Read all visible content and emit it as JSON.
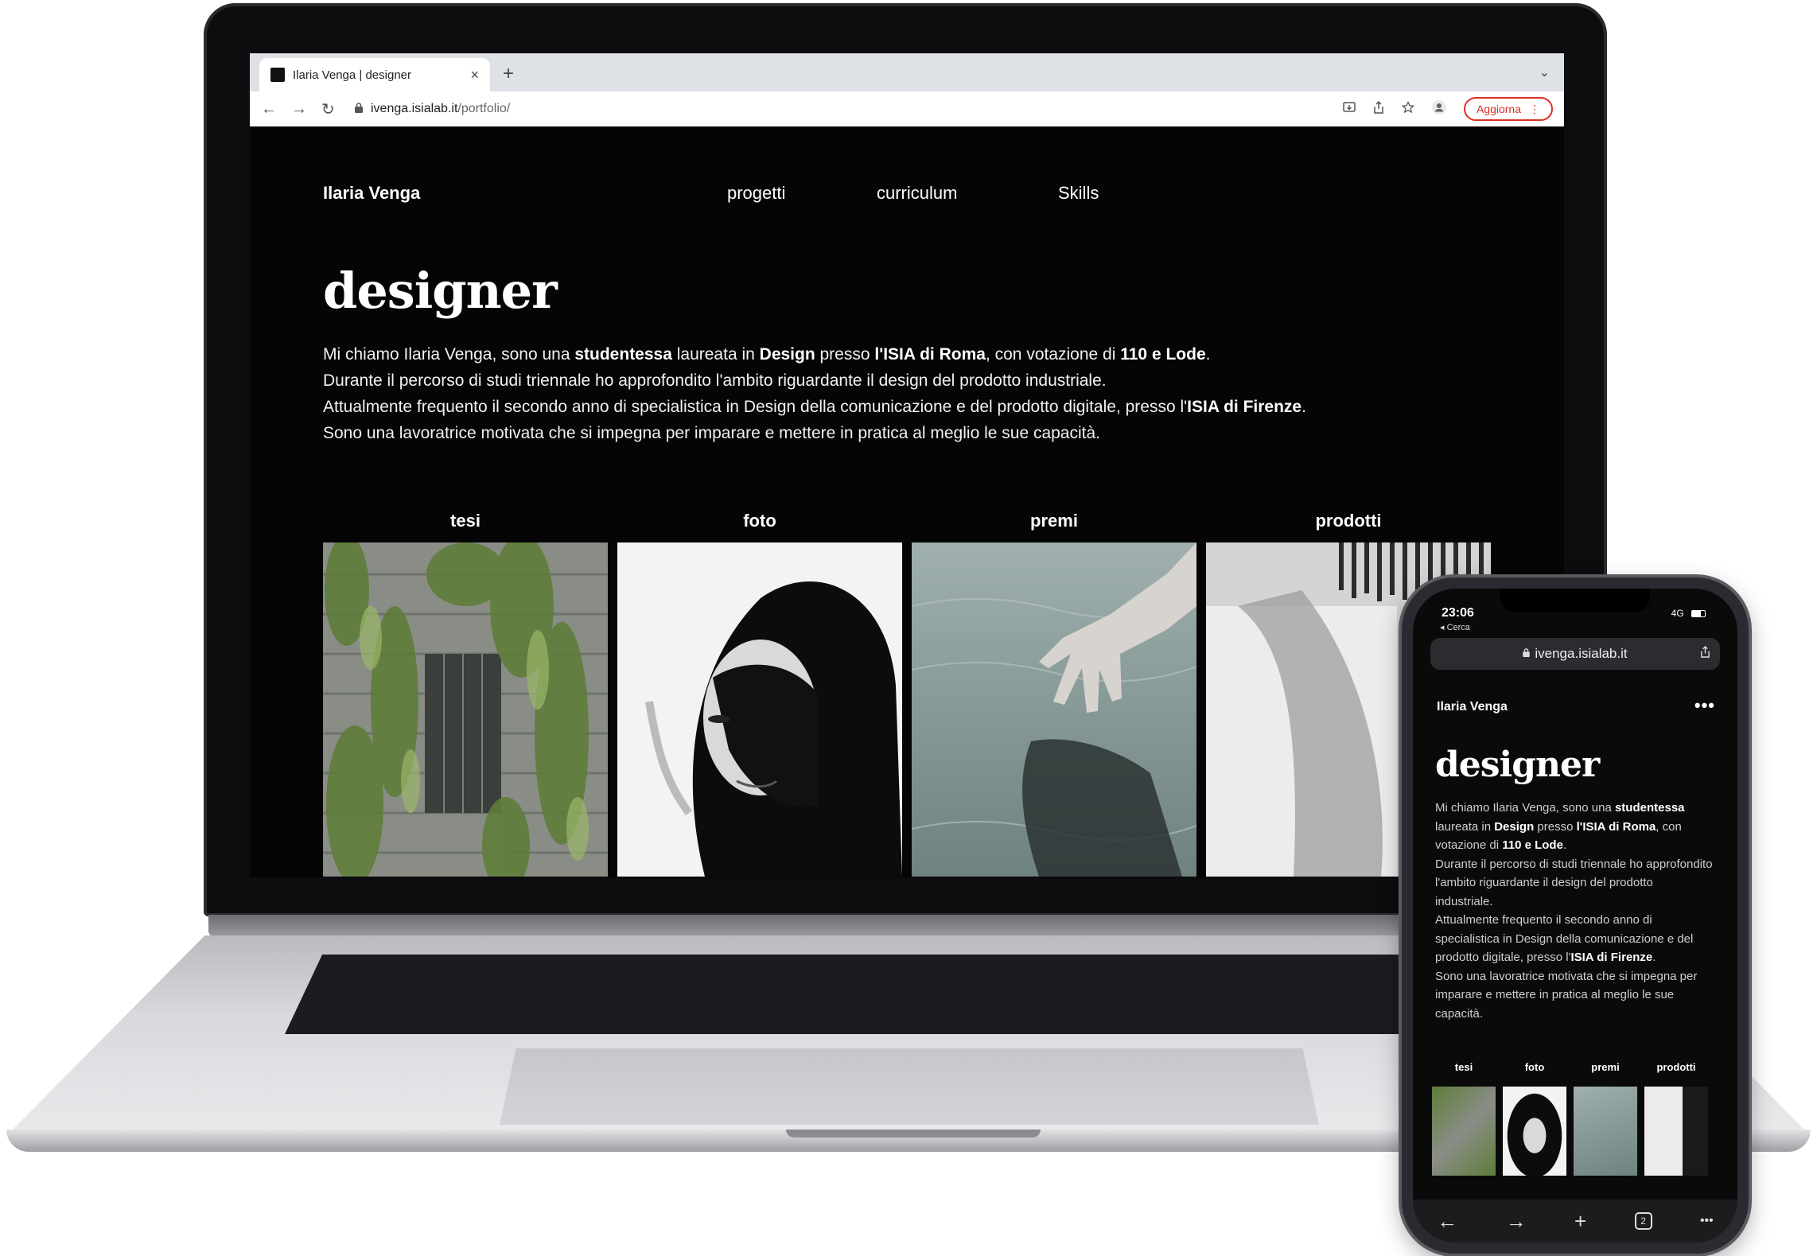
{
  "browser": {
    "tab_title": "Ilaria Venga | designer",
    "tab_close": "×",
    "new_tab": "+",
    "tab_menu": "⌄",
    "nav": {
      "back": "←",
      "forward": "→",
      "reload": "↻"
    },
    "url_host": "ivenga.isialab.it",
    "url_path": "/portfolio/",
    "update_label": "Aggiorna",
    "menu_dots": "⋮"
  },
  "site": {
    "brand": "Ilaria Venga",
    "nav": [
      "progetti",
      "curriculum",
      "Skills"
    ],
    "hero_title": "designer",
    "bio": [
      [
        {
          "t": "Mi chiamo Ilaria Venga, sono una "
        },
        {
          "t": "studentessa",
          "b": true
        },
        {
          "t": " laureata in "
        },
        {
          "t": "Design",
          "b": true
        },
        {
          "t": " presso "
        },
        {
          "t": "l'ISIA di Roma",
          "b": true
        },
        {
          "t": ", con votazione di "
        },
        {
          "t": "110 e Lode",
          "b": true
        },
        {
          "t": "."
        }
      ],
      [
        {
          "t": "Durante il percorso di studi triennale ho approfondito l'ambito riguardante il design del prodotto industriale."
        }
      ],
      [
        {
          "t": "Attualmente frequento il secondo anno di specialistica in Design della comunicazione e del prodotto digitale, presso l'"
        },
        {
          "t": "ISIA di Firenze",
          "b": true
        },
        {
          "t": "."
        }
      ],
      [
        {
          "t": "Sono una lavoratrice motivata che si impegna per imparare e mettere in pratica al meglio le sue capacità."
        }
      ]
    ],
    "categories": [
      {
        "label": "tesi",
        "image": "ivy-covered-building-photo"
      },
      {
        "label": "foto",
        "image": "black-and-white-portrait-photo"
      },
      {
        "label": "premi",
        "image": "hand-touching-water-photo"
      },
      {
        "label": "prodotti",
        "image": "blurred-hand-with-pencils-photo"
      }
    ]
  },
  "phone": {
    "time": "23:06",
    "back_label": "◂ Cerca",
    "signal": "4G",
    "url": "ivenga.isialab.it",
    "brand": "Ilaria Venga",
    "more": "•••",
    "hero_title": "designer",
    "bio": [
      [
        {
          "t": "Mi chiamo Ilaria Venga, sono una "
        },
        {
          "t": "studentessa",
          "b": true
        },
        {
          "t": " laureata in "
        },
        {
          "t": "Design",
          "b": true
        },
        {
          "t": " presso "
        },
        {
          "t": "l'ISIA di Roma",
          "b": true
        },
        {
          "t": ", con votazione di "
        },
        {
          "t": "110 e Lode",
          "b": true
        },
        {
          "t": "."
        }
      ],
      [
        {
          "t": "Durante il percorso di studi triennale ho approfondito l'ambito riguardante il design del prodotto industriale."
        }
      ],
      [
        {
          "t": "Attualmente frequento il secondo anno di specialistica in Design della comunicazione e del prodotto digitale, presso l'"
        },
        {
          "t": "ISIA di Firenze",
          "b": true
        },
        {
          "t": "."
        }
      ],
      [
        {
          "t": "Sono una lavoratrice motivata che si impegna per imparare e mettere in pratica al meglio le sue capacità."
        }
      ]
    ],
    "categories": [
      "tesi",
      "foto",
      "premi",
      "prodotti"
    ],
    "toolbar": {
      "back": "←",
      "forward": "→",
      "new_tab": "+",
      "tabs": "2",
      "more": "•••"
    }
  },
  "colors": {
    "page_bg": "#050505",
    "text": "#ffffff",
    "update_accent": "#d93025"
  }
}
